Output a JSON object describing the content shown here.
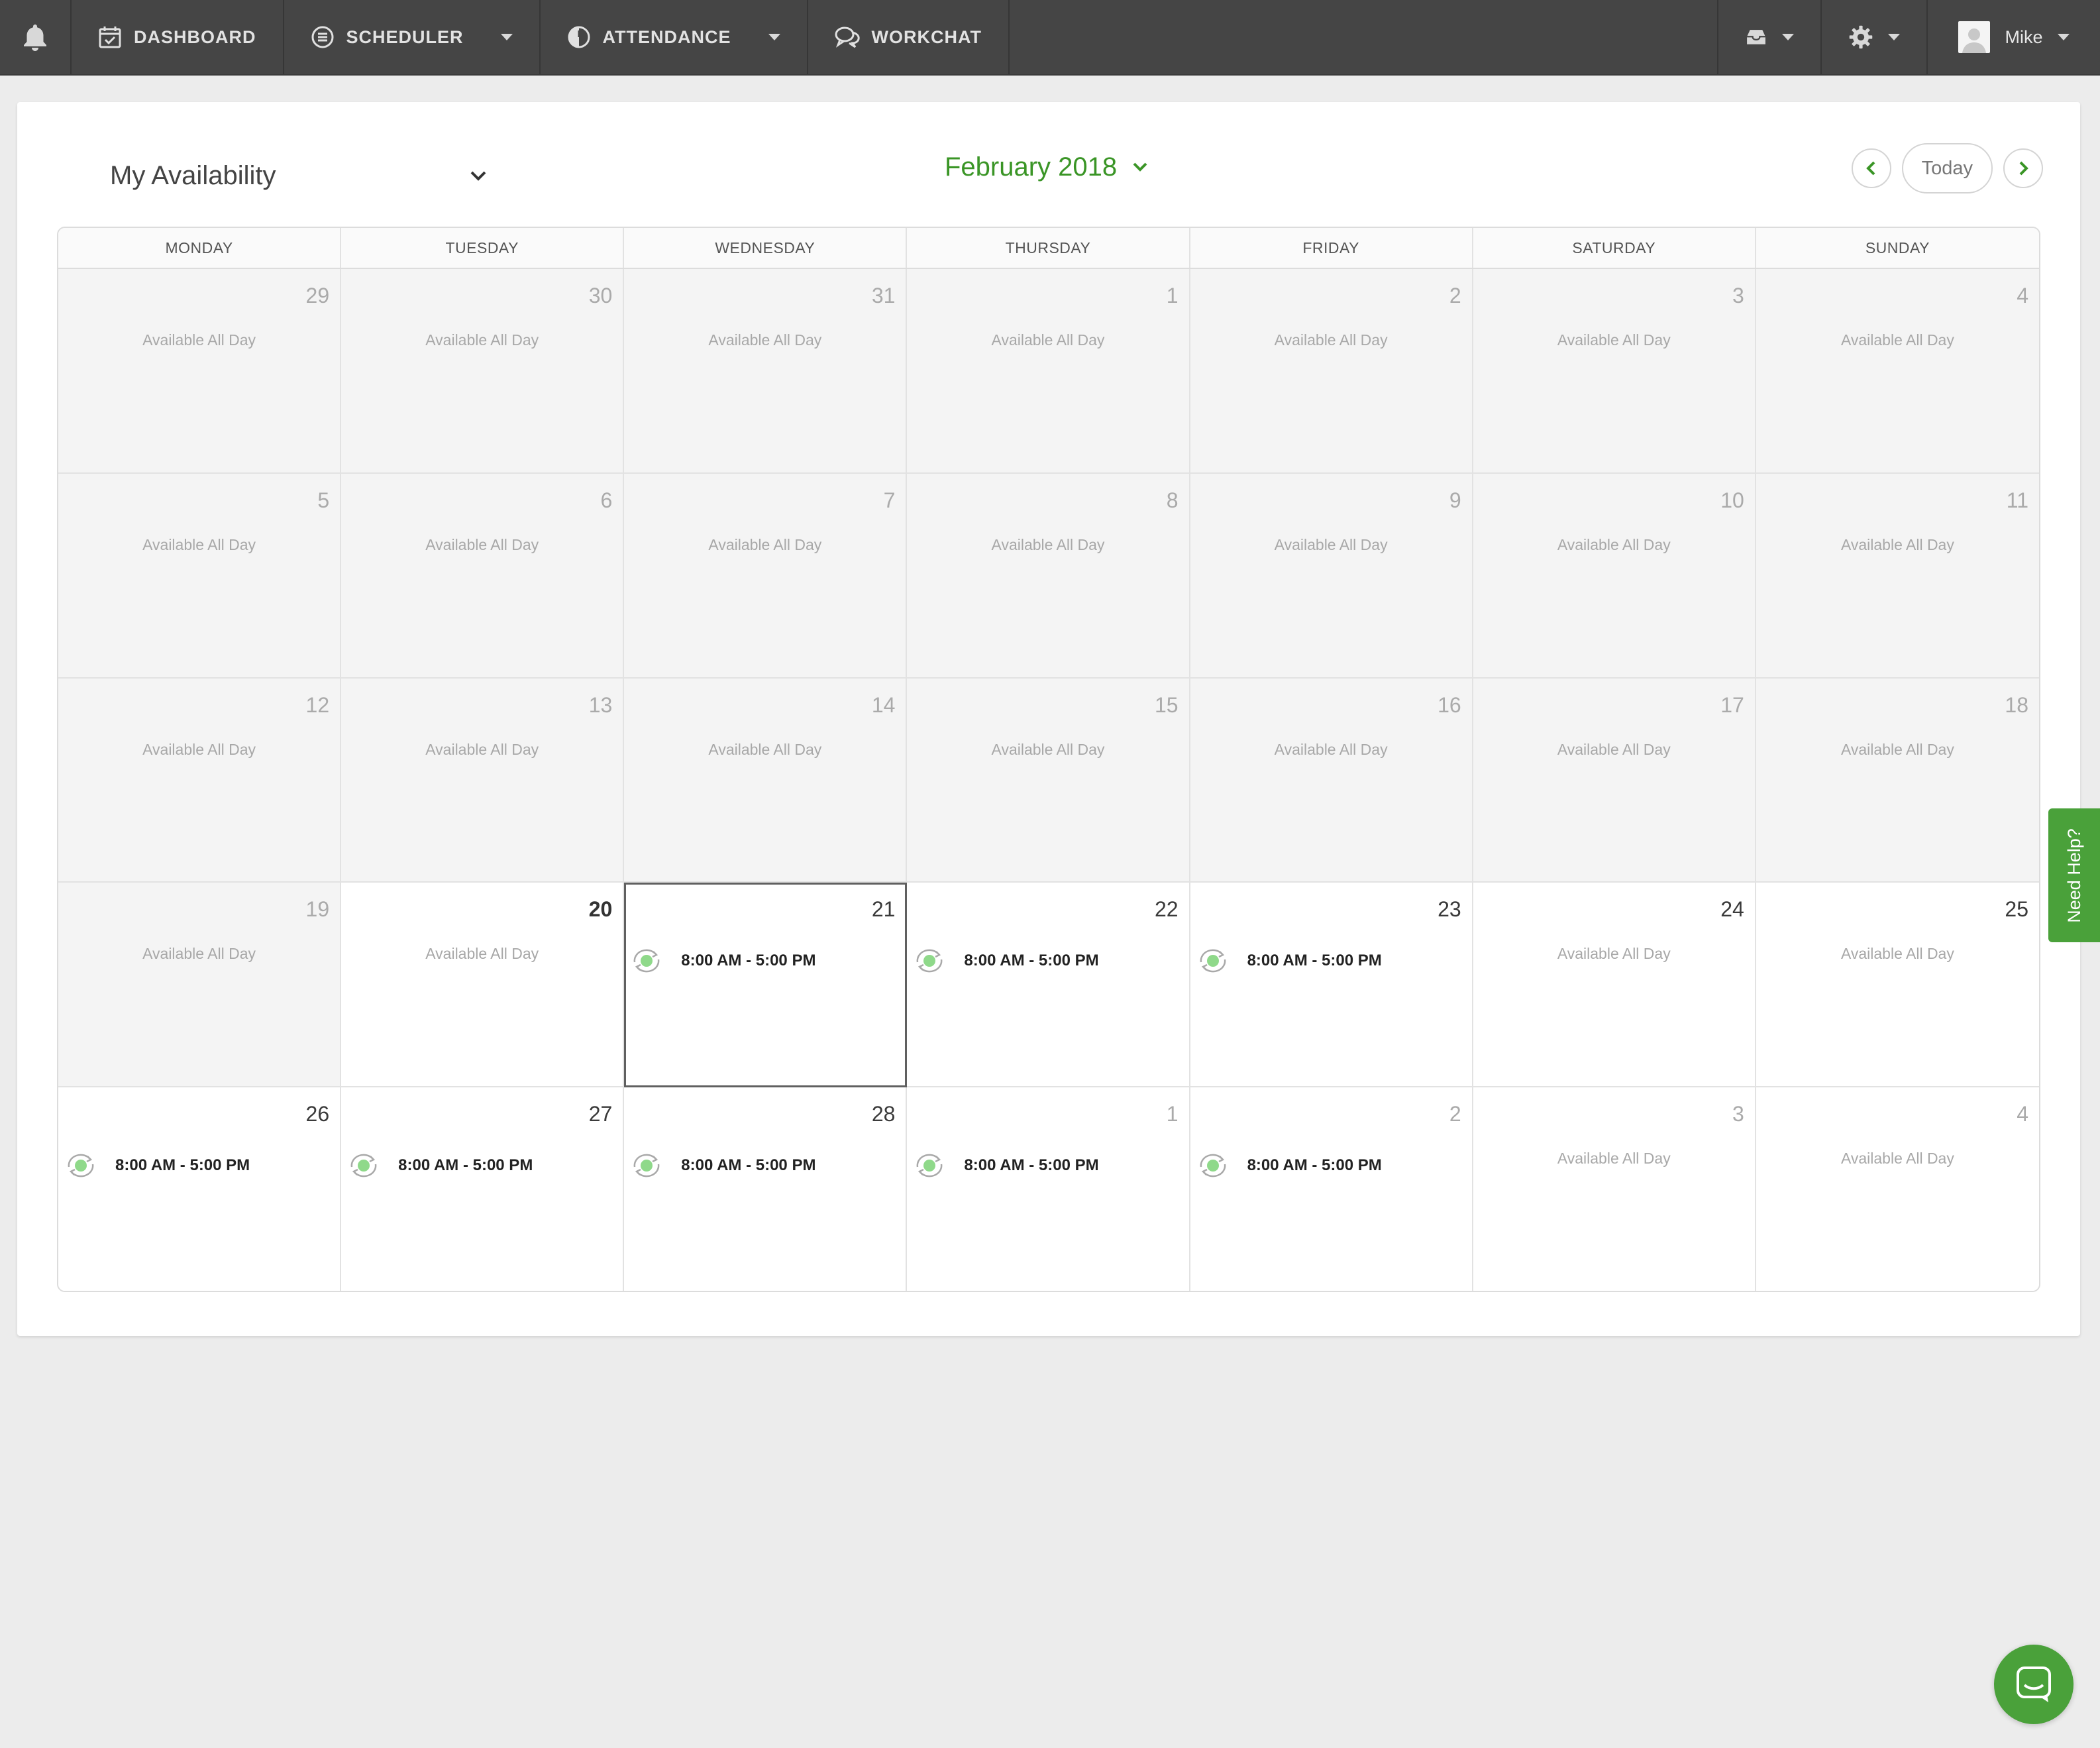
{
  "nav": {
    "bell_icon": "bell-icon",
    "items": [
      {
        "label": "DASHBOARD",
        "icon": "calendar-check-icon"
      },
      {
        "label": "SCHEDULER",
        "icon": "scheduler-icon"
      },
      {
        "label": "ATTENDANCE",
        "icon": "clock-icon"
      },
      {
        "label": "WORKCHAT",
        "icon": "chat-icon"
      }
    ],
    "user_name": "Mike"
  },
  "header": {
    "view_label": "My Availability",
    "month_label": "February 2018",
    "today_label": "Today"
  },
  "weekdays": [
    "MONDAY",
    "TUESDAY",
    "WEDNESDAY",
    "THURSDAY",
    "FRIDAY",
    "SATURDAY",
    "SUNDAY"
  ],
  "available_text": "Available All Day",
  "shift_text": "8:00 AM - 5:00 PM",
  "days": [
    {
      "num": "29",
      "state": "past",
      "status": "available"
    },
    {
      "num": "30",
      "state": "past",
      "status": "available"
    },
    {
      "num": "31",
      "state": "past",
      "status": "available"
    },
    {
      "num": "1",
      "state": "past",
      "status": "available"
    },
    {
      "num": "2",
      "state": "past",
      "status": "available"
    },
    {
      "num": "3",
      "state": "past",
      "status": "available"
    },
    {
      "num": "4",
      "state": "past",
      "status": "available"
    },
    {
      "num": "5",
      "state": "past",
      "status": "available"
    },
    {
      "num": "6",
      "state": "past",
      "status": "available"
    },
    {
      "num": "7",
      "state": "past",
      "status": "available"
    },
    {
      "num": "8",
      "state": "past",
      "status": "available"
    },
    {
      "num": "9",
      "state": "past",
      "status": "available"
    },
    {
      "num": "10",
      "state": "past",
      "status": "available"
    },
    {
      "num": "11",
      "state": "past",
      "status": "available"
    },
    {
      "num": "12",
      "state": "past",
      "status": "available"
    },
    {
      "num": "13",
      "state": "past",
      "status": "available"
    },
    {
      "num": "14",
      "state": "past",
      "status": "available"
    },
    {
      "num": "15",
      "state": "past",
      "status": "available"
    },
    {
      "num": "16",
      "state": "past",
      "status": "available"
    },
    {
      "num": "17",
      "state": "past",
      "status": "available"
    },
    {
      "num": "18",
      "state": "past",
      "status": "available"
    },
    {
      "num": "19",
      "state": "past",
      "status": "available"
    },
    {
      "num": "20",
      "state": "current-bold",
      "status": "available"
    },
    {
      "num": "21",
      "state": "today",
      "status": "shift"
    },
    {
      "num": "22",
      "state": "current",
      "status": "shift"
    },
    {
      "num": "23",
      "state": "current",
      "status": "shift"
    },
    {
      "num": "24",
      "state": "current",
      "status": "available"
    },
    {
      "num": "25",
      "state": "current",
      "status": "available"
    },
    {
      "num": "26",
      "state": "current",
      "status": "shift"
    },
    {
      "num": "27",
      "state": "current",
      "status": "shift"
    },
    {
      "num": "28",
      "state": "current",
      "status": "shift"
    },
    {
      "num": "1",
      "state": "next",
      "status": "shift"
    },
    {
      "num": "2",
      "state": "next",
      "status": "shift"
    },
    {
      "num": "3",
      "state": "next",
      "status": "available"
    },
    {
      "num": "4",
      "state": "next",
      "status": "available"
    }
  ],
  "help_label": "Need Help?",
  "colors": {
    "accent": "#3a9526",
    "nav_bg": "#454545",
    "help_bg": "#4aa13a"
  }
}
